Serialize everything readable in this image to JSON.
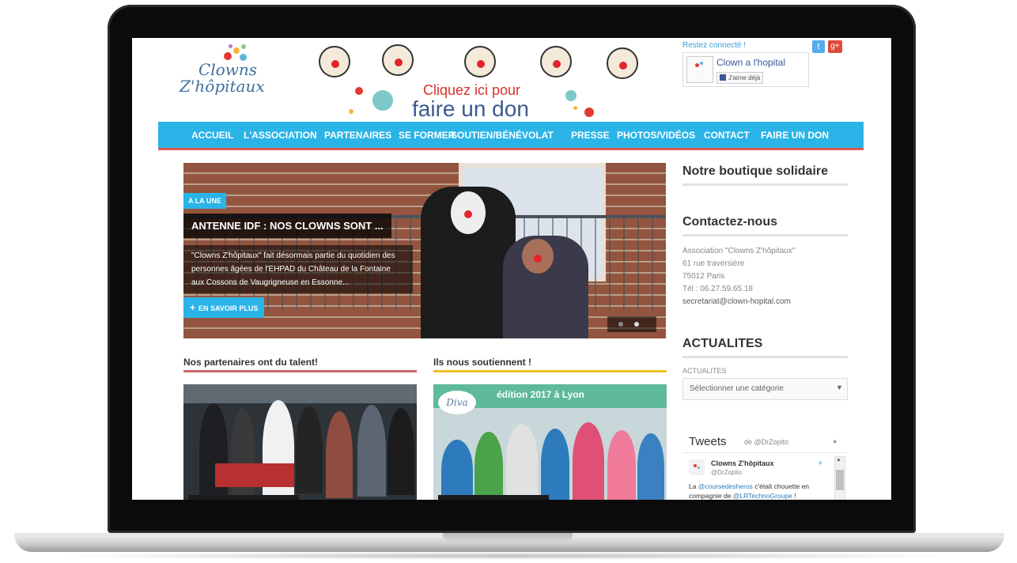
{
  "logo": {
    "line1": "Clowns",
    "line2": "Z'hôpitaux"
  },
  "banner": {
    "cta_line1": "Cliquez ici pour",
    "cta_line2": "faire un don"
  },
  "social": {
    "label": "Restez connecté !",
    "twitter_icon": "twitter-icon",
    "gplus_icon": "google-plus-icon",
    "fb_page_name": "Clown a l'hopital",
    "fb_like_label": "J'aime déjà"
  },
  "nav": {
    "items": [
      "ACCUEIL",
      "L'ASSOCIATION",
      "PARTENAIRES",
      "SE FORMER",
      "SOUTIEN/BÉNÉVOLAT",
      "PRESSE",
      "PHOTOS/VIDÉOS",
      "CONTACT",
      "FAIRE UN DON"
    ]
  },
  "slider": {
    "badge": "A LA UNE",
    "title": "ANTENNE IDF : NOS CLOWNS SONT ...",
    "text": "\"Clowns Z'hôpitaux\" fait désormais partie du quotidien des personnes âgées de l'EHPAD du Château de la Fontaine aux Cossons de Vaugrigneuse en Essonne...",
    "more": "EN SAVOIR PLUS"
  },
  "sections": {
    "partners": {
      "title": "Nos partenaires ont du talent!"
    },
    "supporters": {
      "title": "Ils nous soutiennent !",
      "image_text": "édition 2017 à Lyon",
      "logo_text": "Diva"
    }
  },
  "sidebar": {
    "shop_title": "Notre boutique solidaire",
    "contact_title": "Contactez-nous",
    "contact_lines": [
      "Association \"Clowns Z'hôpitaux\"",
      "61 rue traversière",
      "75012 Paris",
      "Tél : 06.27.59.65.18",
      "secretariat@clown-hopital.com"
    ],
    "news_title": "ACTUALITES",
    "news_label": "ACTUALITES",
    "news_select": "Sélectionner une catégorie"
  },
  "tweets": {
    "title": "Tweets",
    "by": "de @DrZopito",
    "author_name": "Clowns Z'hôpitaux",
    "author_handle": "@DrZopito",
    "msg_part1": "La ",
    "msg_link1": "@coursedesheros",
    "msg_part2": " c'était chouette en compagnie de ",
    "msg_link2": "@LRTechnoGroupe",
    "msg_part3": " !"
  },
  "colors": {
    "nav_bg": "#2ab4e8",
    "nav_border": "#e4584f",
    "partners_line": "#c9676a",
    "supporters_line": "#f0c022",
    "accent": "#2ab4e8"
  }
}
